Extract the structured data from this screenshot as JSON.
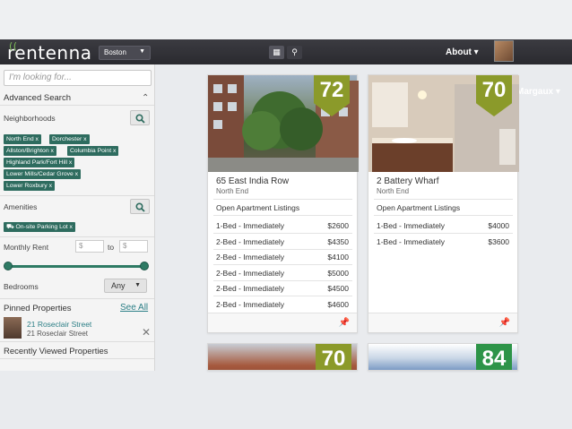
{
  "nav": {
    "logo": "rentenna",
    "city": "Boston",
    "about": "About",
    "user": "Margaux"
  },
  "sidebar": {
    "search_placeholder": "I'm looking for...",
    "advanced_search": "Advanced Search",
    "neighborhoods_label": "Neighborhoods",
    "neighborhood_tags": [
      "North End x",
      "Dorchester x",
      "Allston/Brighton x",
      "Columbia Point x",
      "Highland Park/Fort Hill x",
      "Lower Mills/Cedar Grove x",
      "Lower Roxbury x"
    ],
    "amenities_label": "Amenities",
    "amenity_tags": [
      "On-site Parking Lot x"
    ],
    "monthly_rent_label": "Monthly Rent",
    "rent_min_placeholder": "$",
    "rent_to": "to",
    "rent_max_placeholder": "$",
    "bedrooms_label": "Bedrooms",
    "bedrooms_value": "Any",
    "pinned_title": "Pinned Properties",
    "see_all": "See All",
    "pinned": {
      "link": "21 Roseclair Street",
      "sub": "21 Roseclair Street"
    },
    "recent_title": "Recently Viewed Properties"
  },
  "listings": [
    {
      "score": "72",
      "address": "65 East India Row",
      "neighborhood": "North End",
      "section": "Open Apartment Listings",
      "rows": [
        {
          "unit": "1-Bed - Immediately",
          "price": "$2600"
        },
        {
          "unit": "2-Bed - Immediately",
          "price": "$4350"
        },
        {
          "unit": "2-Bed - Immediately",
          "price": "$4100"
        },
        {
          "unit": "2-Bed - Immediately",
          "price": "$5000"
        },
        {
          "unit": "2-Bed - Immediately",
          "price": "$4500"
        },
        {
          "unit": "2-Bed - Immediately",
          "price": "$4600"
        }
      ]
    },
    {
      "score": "70",
      "address": "2 Battery Wharf",
      "neighborhood": "North End",
      "section": "Open Apartment Listings",
      "rows": [
        {
          "unit": "1-Bed - Immediately",
          "price": "$4000"
        },
        {
          "unit": "1-Bed - Immediately",
          "price": "$3600"
        }
      ]
    },
    {
      "score": "70"
    },
    {
      "score": "84"
    }
  ],
  "colors": {
    "accent": "#2e6c5f",
    "badge_olive": "#8b9a2a",
    "badge_green": "#2d9448",
    "nav": "#2f2f35"
  }
}
